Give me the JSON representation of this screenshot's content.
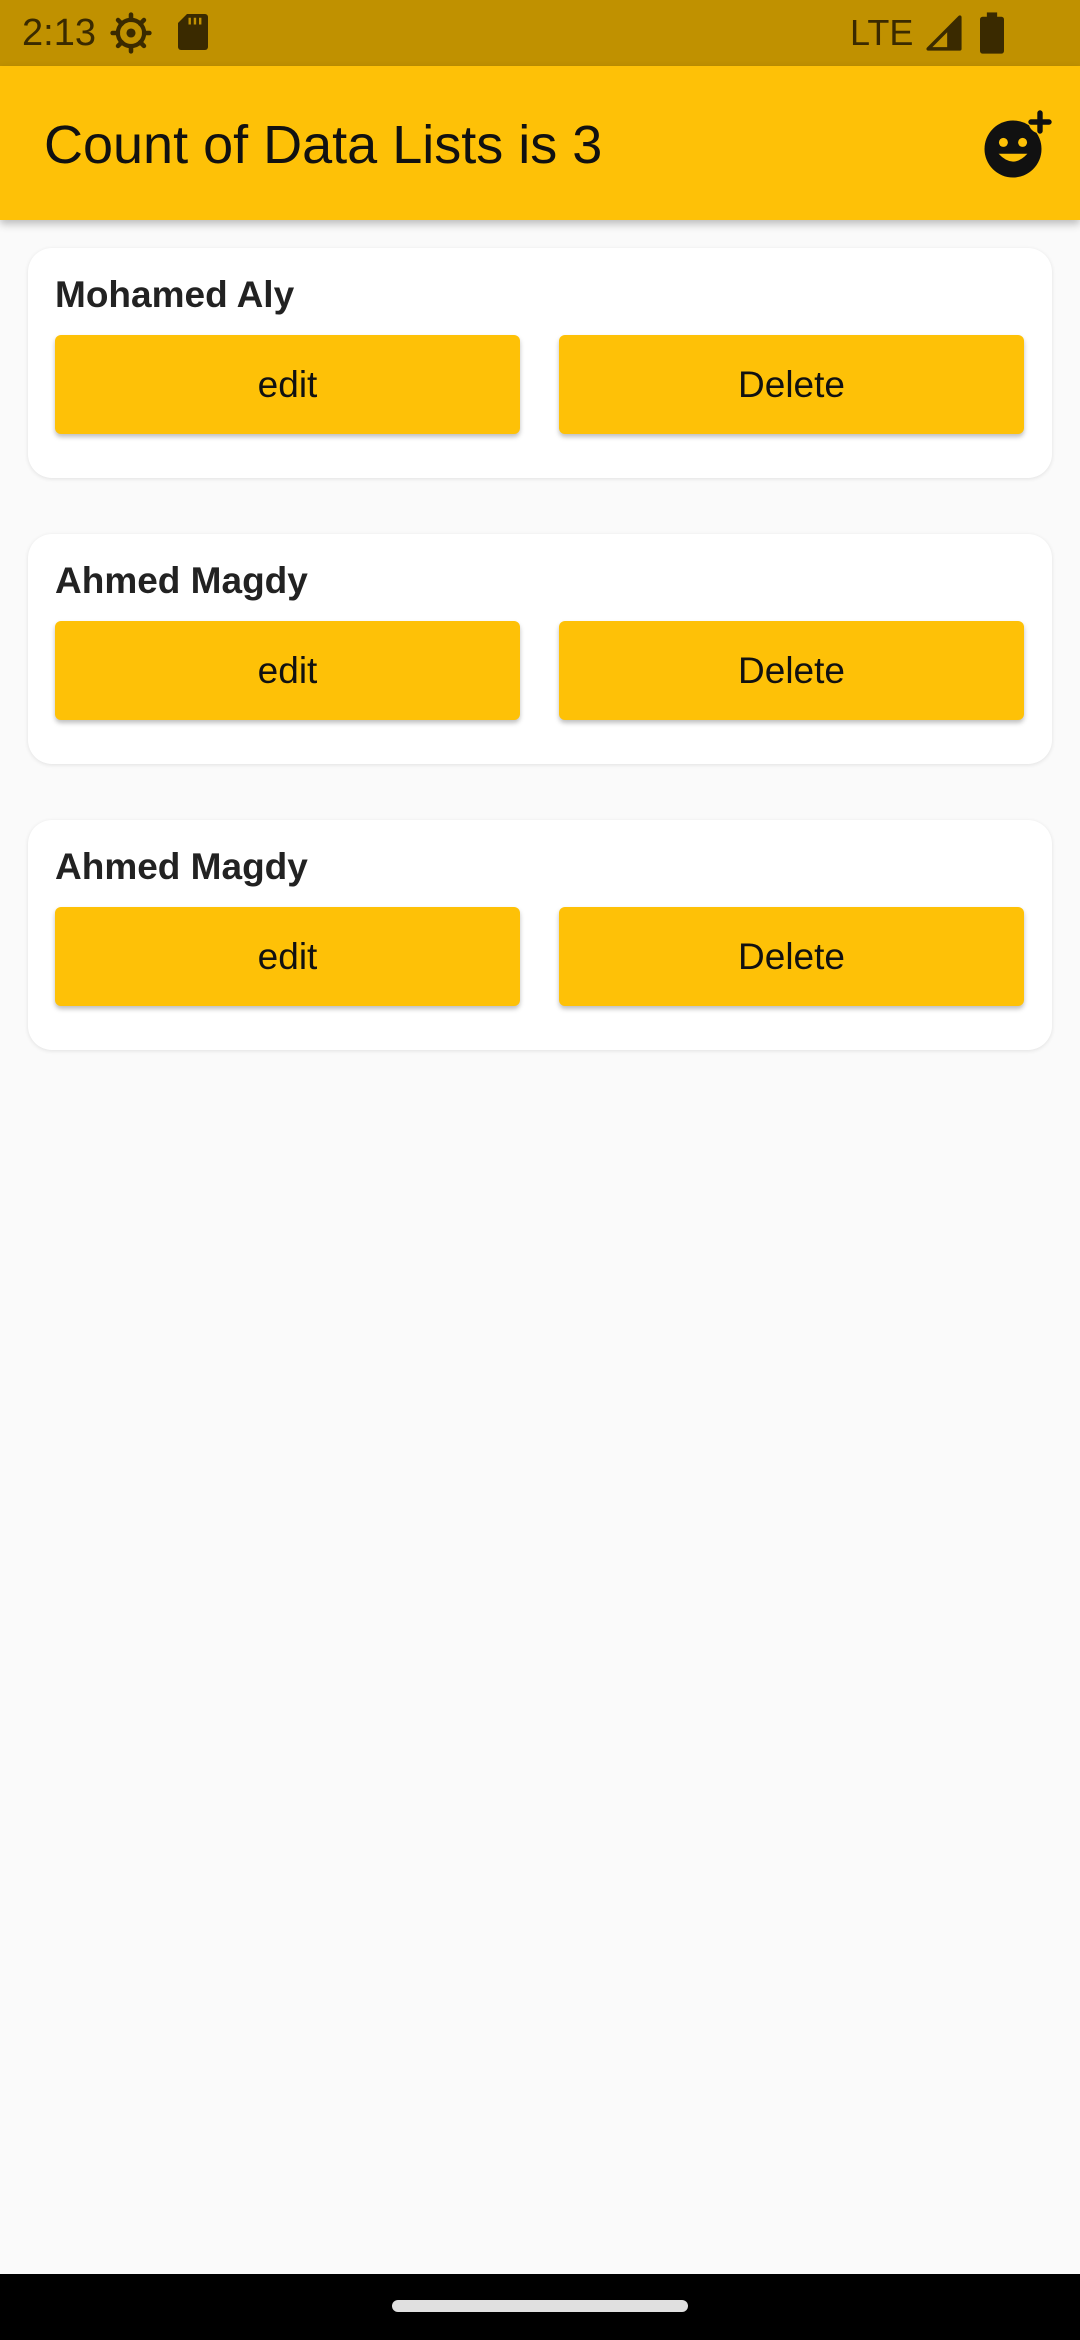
{
  "status_bar": {
    "time": "2:13",
    "network": "LTE",
    "icons": [
      "gear-icon",
      "sd-card-icon",
      "signal-icon",
      "battery-icon"
    ]
  },
  "app_bar": {
    "title": "Count of Data Lists is 3",
    "action_icon": "add-reaction-icon",
    "color": "#fec107"
  },
  "items": [
    {
      "name": "Mohamed Aly",
      "edit_label": "edit",
      "delete_label": "Delete"
    },
    {
      "name": "Ahmed Magdy",
      "edit_label": "edit",
      "delete_label": "Delete"
    },
    {
      "name": "Ahmed Magdy",
      "edit_label": "edit",
      "delete_label": "Delete"
    }
  ],
  "colors": {
    "accent": "#fec107",
    "status_bar": "#c09100",
    "background": "#fafafa"
  }
}
